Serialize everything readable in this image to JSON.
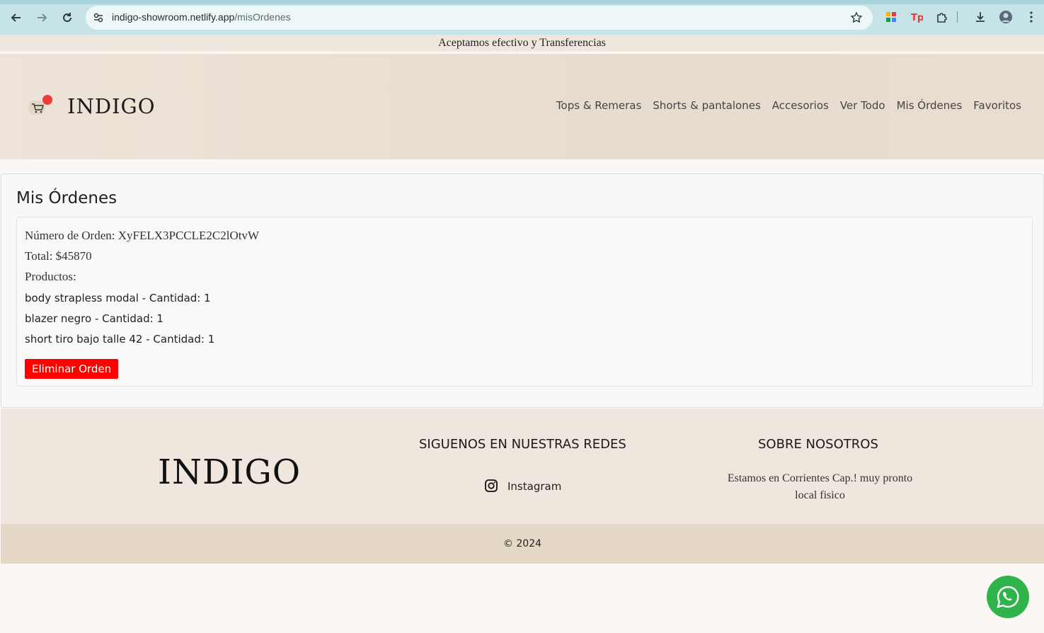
{
  "browser": {
    "url_host": "indigo-showroom.netlify.app",
    "url_path": "/misOrdenes"
  },
  "announcement": "Aceptamos efectivo y Transferencias",
  "header": {
    "logo": "INDIGO",
    "nav": [
      "Tops & Remeras",
      "Shorts & pantalones",
      "Accesorios",
      "Ver Todo",
      "Mis Órdenes",
      "Favoritos"
    ]
  },
  "main": {
    "title": "Mis Órdenes",
    "order": {
      "number_line": "Número de Orden: XyFELX3PCCLE2C2lOtvW",
      "total_line": "Total: $45870",
      "products_label": "Productos:",
      "products": [
        "body strapless modal - Cantidad: 1",
        "blazer negro - Cantidad: 1",
        "short tiro bajo talle 42 - Cantidad: 1"
      ],
      "delete_label": "Eliminar Orden"
    }
  },
  "footer": {
    "logo": "INDIGO",
    "social_heading": "SIGUENOS EN NUESTRAS REDES",
    "instagram_label": "Instagram",
    "about_heading": "SOBRE NOSOTROS",
    "about_line1": "Estamos en Corrientes Cap.! muy pronto",
    "about_line2": "local fisico",
    "copyright": "© 2024"
  },
  "colors": {
    "delete_button": "#ff0000",
    "cart_badge": "#ee3b3b",
    "whatsapp": "#2fb34a"
  }
}
